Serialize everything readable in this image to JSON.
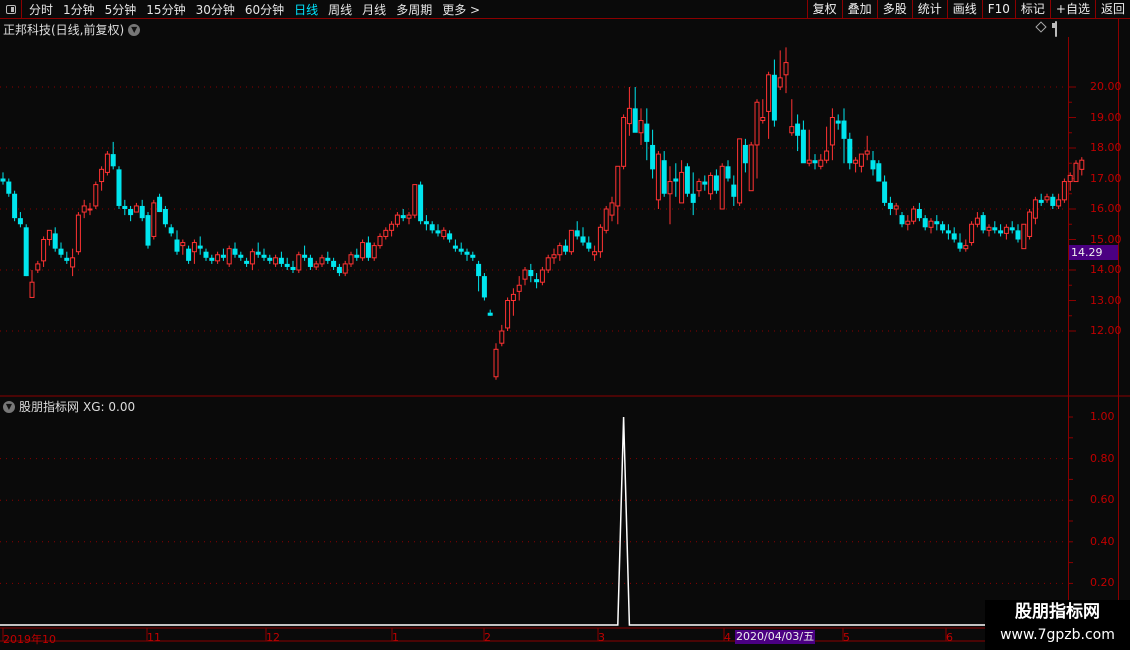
{
  "toolbar": {
    "periods": [
      "分时",
      "1分钟",
      "5分钟",
      "15分钟",
      "30分钟",
      "60分钟",
      "日线",
      "周线",
      "月线",
      "多周期",
      "更多 >"
    ],
    "active": "日线",
    "right_buttons": [
      "复权",
      "叠加",
      "多股",
      "统计",
      "画线",
      "F10",
      "标记",
      "+自选",
      "返回"
    ]
  },
  "main": {
    "title": "正邦科技(日线,前复权)",
    "current_price": "14.29",
    "y_ticks": [
      "20.00",
      "19.00",
      "18.00",
      "17.00",
      "16.00",
      "15.00",
      "14.00",
      "13.00",
      "12.00"
    ]
  },
  "indicator": {
    "title": "股朋指标网",
    "value_label": "XG: 0.00",
    "y_ticks": [
      "1.00",
      "0.80",
      "0.60",
      "0.40",
      "0.20"
    ]
  },
  "x_axis": {
    "labels": [
      "2019年10",
      "11",
      "12",
      "1",
      "2",
      "3",
      "4",
      "5",
      "6"
    ],
    "cursor_date": "2020/04/03/五"
  },
  "watermark": {
    "name": "股朋指标网",
    "url": "www.7gpzb.com"
  },
  "colors": {
    "up": "#ff3333",
    "down": "#00e5ee",
    "axis": "#8b0000",
    "label": "#c00000",
    "highlight": "#4b0082"
  },
  "chart_data": {
    "type": "candlestick",
    "ylim": [
      10.4,
      21.5
    ],
    "ohlc": [
      [
        17.0,
        17.2,
        16.8,
        16.9
      ],
      [
        16.9,
        17.0,
        16.4,
        16.5
      ],
      [
        16.5,
        16.6,
        15.6,
        15.7
      ],
      [
        15.7,
        15.9,
        15.4,
        15.5
      ],
      [
        15.4,
        15.5,
        13.8,
        13.8
      ],
      [
        13.1,
        14.0,
        13.1,
        13.6
      ],
      [
        14.0,
        14.3,
        13.9,
        14.2
      ],
      [
        14.3,
        15.1,
        14.1,
        15.0
      ],
      [
        15.0,
        15.3,
        14.8,
        15.3
      ],
      [
        15.2,
        15.4,
        14.6,
        14.7
      ],
      [
        14.7,
        14.9,
        14.4,
        14.5
      ],
      [
        14.4,
        14.6,
        14.2,
        14.3
      ],
      [
        14.1,
        14.7,
        13.8,
        14.4
      ],
      [
        14.6,
        15.9,
        14.5,
        15.8
      ],
      [
        15.9,
        16.3,
        15.7,
        16.1
      ],
      [
        16.0,
        16.2,
        15.8,
        16.0
      ],
      [
        16.1,
        16.9,
        16.0,
        16.8
      ],
      [
        16.9,
        17.4,
        16.6,
        17.3
      ],
      [
        17.2,
        17.9,
        17.1,
        17.8
      ],
      [
        17.8,
        18.2,
        17.3,
        17.4
      ],
      [
        17.3,
        17.4,
        16.0,
        16.1
      ],
      [
        16.1,
        16.3,
        15.8,
        16.0
      ],
      [
        16.0,
        16.1,
        15.6,
        15.8
      ],
      [
        15.9,
        16.2,
        15.9,
        16.1
      ],
      [
        16.1,
        16.3,
        15.6,
        15.7
      ],
      [
        15.8,
        15.9,
        14.7,
        14.8
      ],
      [
        15.1,
        16.3,
        15.0,
        16.2
      ],
      [
        16.4,
        16.5,
        15.9,
        15.9
      ],
      [
        16.0,
        16.1,
        15.4,
        15.5
      ],
      [
        15.4,
        15.5,
        15.1,
        15.2
      ],
      [
        15.0,
        15.3,
        14.5,
        14.6
      ],
      [
        14.8,
        15.0,
        14.5,
        14.9
      ],
      [
        14.7,
        14.8,
        14.2,
        14.3
      ],
      [
        14.6,
        15.0,
        14.2,
        14.9
      ],
      [
        14.8,
        15.1,
        14.5,
        14.7
      ],
      [
        14.6,
        14.7,
        14.3,
        14.4
      ],
      [
        14.4,
        14.5,
        14.2,
        14.3
      ],
      [
        14.3,
        14.6,
        14.2,
        14.5
      ],
      [
        14.5,
        14.7,
        14.3,
        14.4
      ],
      [
        14.2,
        14.8,
        14.1,
        14.7
      ],
      [
        14.7,
        14.9,
        14.4,
        14.5
      ],
      [
        14.5,
        14.6,
        14.3,
        14.4
      ],
      [
        14.3,
        14.4,
        14.1,
        14.2
      ],
      [
        14.2,
        14.7,
        14.0,
        14.6
      ],
      [
        14.6,
        14.9,
        14.4,
        14.5
      ],
      [
        14.5,
        14.7,
        14.3,
        14.4
      ],
      [
        14.4,
        14.5,
        14.2,
        14.3
      ],
      [
        14.2,
        14.5,
        14.1,
        14.4
      ],
      [
        14.4,
        14.6,
        14.1,
        14.2
      ],
      [
        14.2,
        14.4,
        14.0,
        14.1
      ],
      [
        14.1,
        14.3,
        13.9,
        14.0
      ],
      [
        14.0,
        14.6,
        13.9,
        14.5
      ],
      [
        14.5,
        14.8,
        14.3,
        14.4
      ],
      [
        14.4,
        14.5,
        14.0,
        14.1
      ],
      [
        14.1,
        14.3,
        14.0,
        14.2
      ],
      [
        14.2,
        14.5,
        14.1,
        14.4
      ],
      [
        14.4,
        14.6,
        14.2,
        14.3
      ],
      [
        14.3,
        14.4,
        14.0,
        14.1
      ],
      [
        14.1,
        14.2,
        13.8,
        13.9
      ],
      [
        13.9,
        14.3,
        13.8,
        14.2
      ],
      [
        14.2,
        14.6,
        14.1,
        14.5
      ],
      [
        14.5,
        14.7,
        14.3,
        14.4
      ],
      [
        14.4,
        15.0,
        14.3,
        14.9
      ],
      [
        14.9,
        15.1,
        14.3,
        14.4
      ],
      [
        14.4,
        14.9,
        14.3,
        14.8
      ],
      [
        14.8,
        15.2,
        14.7,
        15.1
      ],
      [
        15.1,
        15.4,
        15.0,
        15.3
      ],
      [
        15.3,
        15.6,
        15.1,
        15.5
      ],
      [
        15.5,
        15.9,
        15.4,
        15.8
      ],
      [
        15.8,
        16.0,
        15.6,
        15.7
      ],
      [
        15.7,
        15.9,
        15.5,
        15.8
      ],
      [
        15.8,
        16.8,
        15.7,
        16.8
      ],
      [
        16.8,
        16.9,
        15.5,
        15.6
      ],
      [
        15.6,
        15.8,
        15.3,
        15.5
      ],
      [
        15.5,
        15.6,
        15.2,
        15.3
      ],
      [
        15.3,
        15.5,
        15.1,
        15.2
      ],
      [
        15.1,
        15.4,
        15.0,
        15.3
      ],
      [
        15.2,
        15.3,
        14.9,
        15.0
      ],
      [
        14.8,
        15.0,
        14.6,
        14.7
      ],
      [
        14.7,
        14.9,
        14.5,
        14.6
      ],
      [
        14.6,
        14.7,
        14.3,
        14.5
      ],
      [
        14.5,
        14.6,
        14.3,
        14.4
      ],
      [
        14.2,
        14.3,
        13.3,
        13.8
      ],
      [
        13.8,
        13.9,
        13.0,
        13.1
      ],
      [
        12.6,
        12.7,
        12.5,
        12.5
      ],
      [
        10.5,
        11.6,
        10.4,
        11.4
      ],
      [
        11.6,
        12.2,
        11.5,
        12.0
      ],
      [
        12.1,
        13.1,
        12.0,
        13.0
      ],
      [
        13.0,
        13.4,
        12.5,
        13.2
      ],
      [
        13.3,
        13.8,
        13.0,
        13.5
      ],
      [
        13.7,
        14.1,
        13.5,
        14.0
      ],
      [
        14.0,
        14.2,
        13.6,
        13.8
      ],
      [
        13.7,
        13.9,
        13.4,
        13.6
      ],
      [
        13.6,
        14.1,
        13.5,
        14.0
      ],
      [
        14.0,
        14.5,
        13.9,
        14.4
      ],
      [
        14.4,
        14.7,
        14.2,
        14.5
      ],
      [
        14.5,
        14.9,
        14.3,
        14.8
      ],
      [
        14.8,
        15.0,
        14.5,
        14.6
      ],
      [
        14.6,
        15.3,
        14.5,
        15.3
      ],
      [
        15.3,
        15.6,
        15.0,
        15.1
      ],
      [
        15.1,
        15.4,
        14.8,
        14.9
      ],
      [
        14.9,
        15.1,
        14.6,
        14.7
      ],
      [
        14.5,
        14.8,
        14.3,
        14.6
      ],
      [
        14.6,
        15.5,
        14.4,
        15.4
      ],
      [
        15.3,
        16.1,
        15.2,
        16.0
      ],
      [
        15.8,
        16.4,
        15.6,
        16.2
      ],
      [
        16.1,
        17.4,
        15.5,
        17.4
      ],
      [
        17.4,
        19.1,
        17.3,
        19.0
      ],
      [
        18.8,
        20.0,
        18.4,
        19.3
      ],
      [
        19.3,
        20.0,
        18.8,
        18.5
      ],
      [
        18.5,
        19.3,
        18.1,
        18.9
      ],
      [
        18.8,
        19.3,
        17.6,
        18.2
      ],
      [
        18.1,
        18.6,
        17.0,
        17.3
      ],
      [
        16.3,
        17.9,
        16.0,
        17.8
      ],
      [
        17.6,
        17.9,
        16.4,
        16.5
      ],
      [
        16.5,
        17.4,
        15.5,
        16.9
      ],
      [
        17.0,
        17.5,
        16.4,
        16.9
      ],
      [
        16.2,
        17.6,
        16.2,
        17.2
      ],
      [
        17.4,
        17.5,
        16.4,
        16.5
      ],
      [
        16.5,
        17.2,
        15.8,
        16.2
      ],
      [
        16.6,
        17.0,
        16.4,
        16.9
      ],
      [
        16.9,
        17.1,
        16.6,
        16.8
      ],
      [
        16.5,
        17.2,
        16.3,
        17.1
      ],
      [
        17.1,
        17.3,
        16.5,
        16.6
      ],
      [
        16.0,
        17.5,
        16.0,
        17.4
      ],
      [
        17.4,
        17.6,
        16.9,
        17.0
      ],
      [
        16.8,
        17.1,
        16.1,
        16.4
      ],
      [
        16.2,
        18.3,
        16.1,
        18.3
      ],
      [
        18.1,
        18.3,
        17.2,
        17.5
      ],
      [
        16.6,
        18.2,
        16.6,
        18.1
      ],
      [
        18.1,
        19.6,
        17.0,
        19.5
      ],
      [
        18.9,
        19.6,
        18.8,
        19.0
      ],
      [
        19.2,
        20.5,
        18.3,
        20.4
      ],
      [
        20.4,
        20.9,
        18.7,
        18.9
      ],
      [
        20.0,
        21.2,
        19.9,
        20.3
      ],
      [
        20.4,
        21.3,
        19.8,
        20.8
      ],
      [
        18.5,
        19.6,
        18.4,
        18.7
      ],
      [
        18.8,
        19.1,
        17.9,
        18.4
      ],
      [
        18.6,
        18.9,
        17.7,
        17.5
      ],
      [
        17.5,
        18.6,
        17.4,
        17.6
      ],
      [
        17.6,
        17.8,
        17.3,
        17.5
      ],
      [
        17.4,
        17.8,
        17.3,
        17.6
      ],
      [
        17.6,
        18.7,
        17.5,
        17.9
      ],
      [
        18.1,
        19.3,
        17.6,
        19.0
      ],
      [
        18.9,
        19.1,
        18.6,
        18.8
      ],
      [
        18.9,
        19.3,
        17.5,
        18.3
      ],
      [
        18.3,
        18.5,
        17.3,
        17.5
      ],
      [
        17.5,
        17.7,
        17.2,
        17.6
      ],
      [
        17.4,
        17.8,
        17.2,
        17.8
      ],
      [
        17.8,
        18.4,
        17.6,
        17.9
      ],
      [
        17.6,
        17.9,
        17.1,
        17.3
      ],
      [
        17.5,
        17.6,
        17.0,
        16.9
      ],
      [
        16.9,
        17.1,
        16.1,
        16.2
      ],
      [
        16.2,
        16.4,
        15.8,
        16.0
      ],
      [
        16.0,
        16.2,
        15.8,
        16.1
      ],
      [
        15.8,
        15.9,
        15.4,
        15.5
      ],
      [
        15.5,
        15.8,
        15.3,
        15.6
      ],
      [
        15.6,
        16.1,
        15.5,
        16.0
      ],
      [
        16.0,
        16.2,
        15.6,
        15.7
      ],
      [
        15.7,
        15.8,
        15.3,
        15.4
      ],
      [
        15.4,
        15.7,
        15.2,
        15.6
      ],
      [
        15.6,
        15.8,
        15.3,
        15.5
      ],
      [
        15.5,
        15.6,
        15.2,
        15.3
      ],
      [
        15.3,
        15.5,
        15.0,
        15.2
      ],
      [
        15.2,
        15.4,
        14.9,
        15.0
      ],
      [
        14.9,
        15.2,
        14.6,
        14.7
      ],
      [
        14.7,
        15.0,
        14.6,
        14.8
      ],
      [
        14.9,
        15.6,
        14.8,
        15.5
      ],
      [
        15.5,
        15.9,
        15.4,
        15.7
      ],
      [
        15.8,
        15.9,
        15.2,
        15.3
      ],
      [
        15.3,
        15.5,
        15.1,
        15.4
      ],
      [
        15.4,
        15.6,
        15.2,
        15.3
      ],
      [
        15.3,
        15.5,
        15.1,
        15.2
      ],
      [
        15.2,
        15.5,
        15.0,
        15.4
      ],
      [
        15.4,
        15.6,
        15.2,
        15.3
      ],
      [
        15.3,
        15.5,
        14.9,
        15.0
      ],
      [
        14.7,
        15.3,
        14.7,
        15.5
      ],
      [
        15.1,
        16.0,
        15.0,
        15.9
      ],
      [
        15.7,
        16.4,
        15.5,
        16.3
      ],
      [
        16.3,
        16.5,
        16.1,
        16.2
      ],
      [
        16.3,
        16.5,
        16.2,
        16.4
      ],
      [
        16.4,
        16.5,
        16.0,
        16.1
      ],
      [
        16.1,
        16.5,
        16.0,
        16.3
      ],
      [
        16.3,
        17.0,
        16.2,
        16.9
      ],
      [
        16.9,
        17.2,
        16.6,
        17.1
      ],
      [
        16.9,
        17.6,
        16.9,
        17.5
      ],
      [
        17.3,
        17.7,
        17.1,
        17.6
      ]
    ],
    "xg_signal_index": 107
  }
}
